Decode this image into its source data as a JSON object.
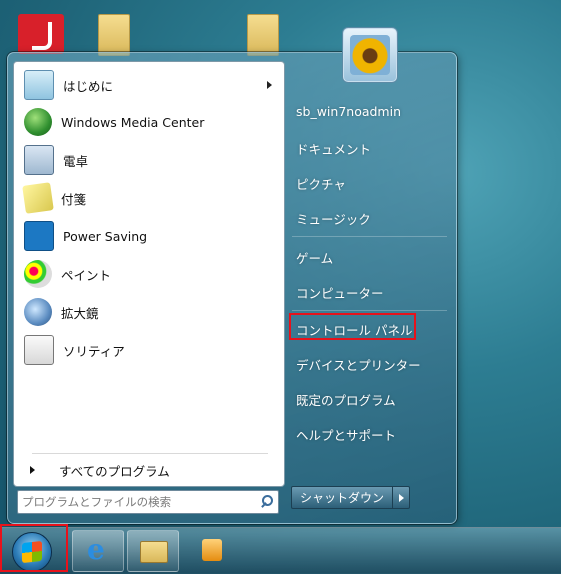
{
  "left_menu": {
    "items": [
      {
        "label": "はじめに",
        "icon": "getting-started-icon",
        "has_submenu": true
      },
      {
        "label": "Windows Media Center",
        "icon": "windows-media-center-icon"
      },
      {
        "label": "電卓",
        "icon": "calculator-icon"
      },
      {
        "label": "付箋",
        "icon": "sticky-notes-icon"
      },
      {
        "label": "Power Saving",
        "icon": "energy-star-icon"
      },
      {
        "label": "ペイント",
        "icon": "paint-icon"
      },
      {
        "label": "拡大鏡",
        "icon": "magnifier-icon"
      },
      {
        "label": "ソリティア",
        "icon": "solitaire-icon"
      }
    ],
    "all_programs": "すべてのプログラム",
    "search_placeholder": "プログラムとファイルの検索"
  },
  "right_menu": {
    "user": "sb_win7noadmin",
    "items": [
      "ドキュメント",
      "ピクチャ",
      "ミュージック",
      "ゲーム",
      "コンピューター",
      "コントロール パネル",
      "デバイスとプリンター",
      "既定のプログラム",
      "ヘルプとサポート"
    ],
    "highlighted": "コントロール パネル",
    "shutdown_label": "シャットダウン"
  },
  "taskbar": {
    "buttons": [
      "start-orb",
      "internet-explorer",
      "windows-explorer",
      "windows-media-player"
    ]
  },
  "colors": {
    "highlight_border": "#e8121b"
  }
}
